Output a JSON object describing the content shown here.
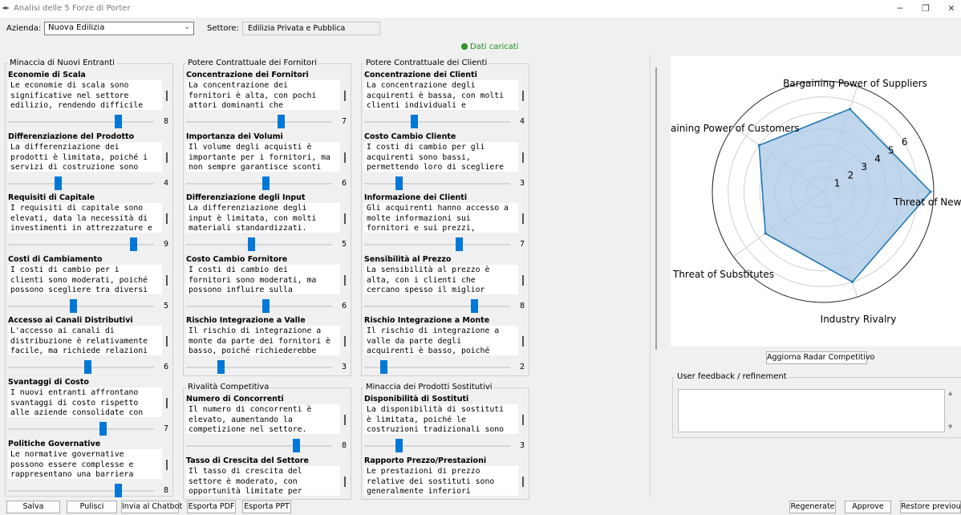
{
  "window": {
    "title": "Analisi delle 5 Forze di Porter",
    "min": "─",
    "max": "❐",
    "close": "✕"
  },
  "header": {
    "azienda_label": "Azienda:",
    "azienda_value": "Nuova Edilizia",
    "settore_label": "Settore:",
    "settore_value": "Edilizia Privata e Pubblica",
    "status": "Dati caricati"
  },
  "groups": [
    {
      "title": "Minaccia di Nuovi Entranti",
      "fields": [
        {
          "label": "Economie di Scala",
          "lines": [
            "Le economie di scala sono",
            "significative nel settore",
            "edilizio, rendendo difficile"
          ],
          "value": 8
        },
        {
          "label": "Differenziazione del Prodotto",
          "lines": [
            "La differenziazione dei",
            "prodotti è limitata, poiché i",
            "servizi di costruzione sono"
          ],
          "value": 4
        },
        {
          "label": "Requisiti di Capitale",
          "lines": [
            "I requisiti di capitale sono",
            "elevati, data la necessità di",
            "investimenti in attrezzature e"
          ],
          "value": 9
        },
        {
          "label": "Costi di Cambiamento",
          "lines": [
            "I costi di cambio per i",
            "clienti sono moderati, poiché",
            "possono scegliere tra diversi"
          ],
          "value": 5
        },
        {
          "label": "Accesso ai Canali Distributivi",
          "lines": [
            "L'accesso ai canali di",
            "distribuzione è relativamente",
            "facile, ma richiede relazioni"
          ],
          "value": 6
        },
        {
          "label": "Svantaggi di Costo",
          "lines": [
            "I nuovi entranti affrontano",
            "svantaggi di costo rispetto",
            "alle aziende consolidate con"
          ],
          "value": 7
        },
        {
          "label": "Politiche Governative",
          "lines": [
            "Le normative governative",
            "possono essere complesse e",
            "rappresentano una barriera"
          ],
          "value": 8
        }
      ]
    },
    {
      "title": "Potere Contrattuale dei Fornitori",
      "fields": [
        {
          "label": "Concentrazione dei Fornitori",
          "lines": [
            "La concentrazione dei",
            "fornitori è alta, con pochi",
            "attori dominanti che"
          ],
          "value": 7
        },
        {
          "label": "Importanza dei Volumi",
          "lines": [
            "Il volume degli acquisti è",
            "importante per i fornitori, ma",
            "non sempre garantisce sconti"
          ],
          "value": 6
        },
        {
          "label": "Differenziazione degli Input",
          "lines": [
            "La differenziazione degli",
            "input è limitata, con molti",
            "materiali standardizzati."
          ],
          "value": 5
        },
        {
          "label": "Costo Cambio Fornitore",
          "lines": [
            "I costi di cambio dei",
            "fornitori sono moderati, ma",
            "possono influire sulla"
          ],
          "value": 6
        },
        {
          "label": "Rischio Integrazione a Valle",
          "lines": [
            "Il rischio di integrazione a",
            "monte da parte dei fornitori è",
            "basso, poiché richiederebbe"
          ],
          "value": 3
        }
      ]
    },
    {
      "title": "Potere Contrattuale dei Clienti",
      "fields": [
        {
          "label": "Concentrazione dei Clienti",
          "lines": [
            "La concentrazione degli",
            "acquirenti è bassa, con molti",
            "clienti individuali e"
          ],
          "value": 4
        },
        {
          "label": "Costo Cambio Cliente",
          "lines": [
            "I costi di cambio per gli",
            "acquirenti sono bassi,",
            "permettendo loro di scegliere"
          ],
          "value": 3
        },
        {
          "label": "Informazione dei Clienti",
          "lines": [
            "Gli acquirenti hanno accesso a",
            "molte informazioni sui",
            "fornitori e sui prezzi,"
          ],
          "value": 7
        },
        {
          "label": "Sensibilità al Prezzo",
          "lines": [
            "La sensibilità al prezzo è",
            "alta, con i clienti che",
            "cercano spesso il miglior"
          ],
          "value": 8
        },
        {
          "label": "Rischio Integrazione a Monte",
          "lines": [
            "Il rischio di integrazione a",
            "valle da parte degli",
            "acquirenti è basso, poiché"
          ],
          "value": 2
        }
      ]
    },
    {
      "title": "Rivalità Competitiva",
      "fields": [
        {
          "label": "Numero di Concorrenti",
          "lines": [
            "Il numero di concorrenti è",
            "elevato, aumentando la",
            "competizione nel settore."
          ],
          "value": 8
        },
        {
          "label": "Tasso di Crescita del Settore",
          "lines": [
            "Il tasso di crescita del",
            "settore è moderato, con",
            "opportunità limitate per"
          ],
          "value": null
        }
      ]
    },
    {
      "title": "Minaccia dei Prodotti Sostitutivi",
      "fields": [
        {
          "label": "Disponibilità di Sostituti",
          "lines": [
            "La disponibilità di sostituti",
            "è limitata, poiché le",
            "costruzioni tradizionali sono"
          ],
          "value": 3
        },
        {
          "label": "Rapporto Prezzo/Prestazioni",
          "lines": [
            "Le prestazioni di prezzo",
            "relative dei sostituti sono",
            "generalmente inferiori"
          ],
          "value": null
        }
      ]
    }
  ],
  "radar": {
    "button": "Aggiorna Radar Competitivo",
    "feedback_title": "User feedback / refinement",
    "feedback_text": "",
    "chart_data": {
      "type": "radar",
      "axes": [
        "Threat of New E",
        "Bargaining Power of Suppliers",
        "aining Power of Customers",
        "Threat of Substitutes",
        "Industry Rivalry"
      ],
      "values": [
        6.8,
        5.5,
        5.0,
        4.5,
        6.0
      ],
      "rlim": [
        0,
        7
      ],
      "rticks": [
        1,
        2,
        3,
        4,
        5,
        6
      ],
      "color": "#1f77b4",
      "fill": "#aac8e6"
    }
  },
  "footer": {
    "salva": "Salva",
    "pulisci": "Pulisci",
    "chatbot": "Invia al Chatbot",
    "pdf": "Esporta PDF",
    "ppt": "Esporta PPT",
    "regenerate": "Regenerate",
    "approve": "Approve",
    "restore": "Restore previous"
  }
}
